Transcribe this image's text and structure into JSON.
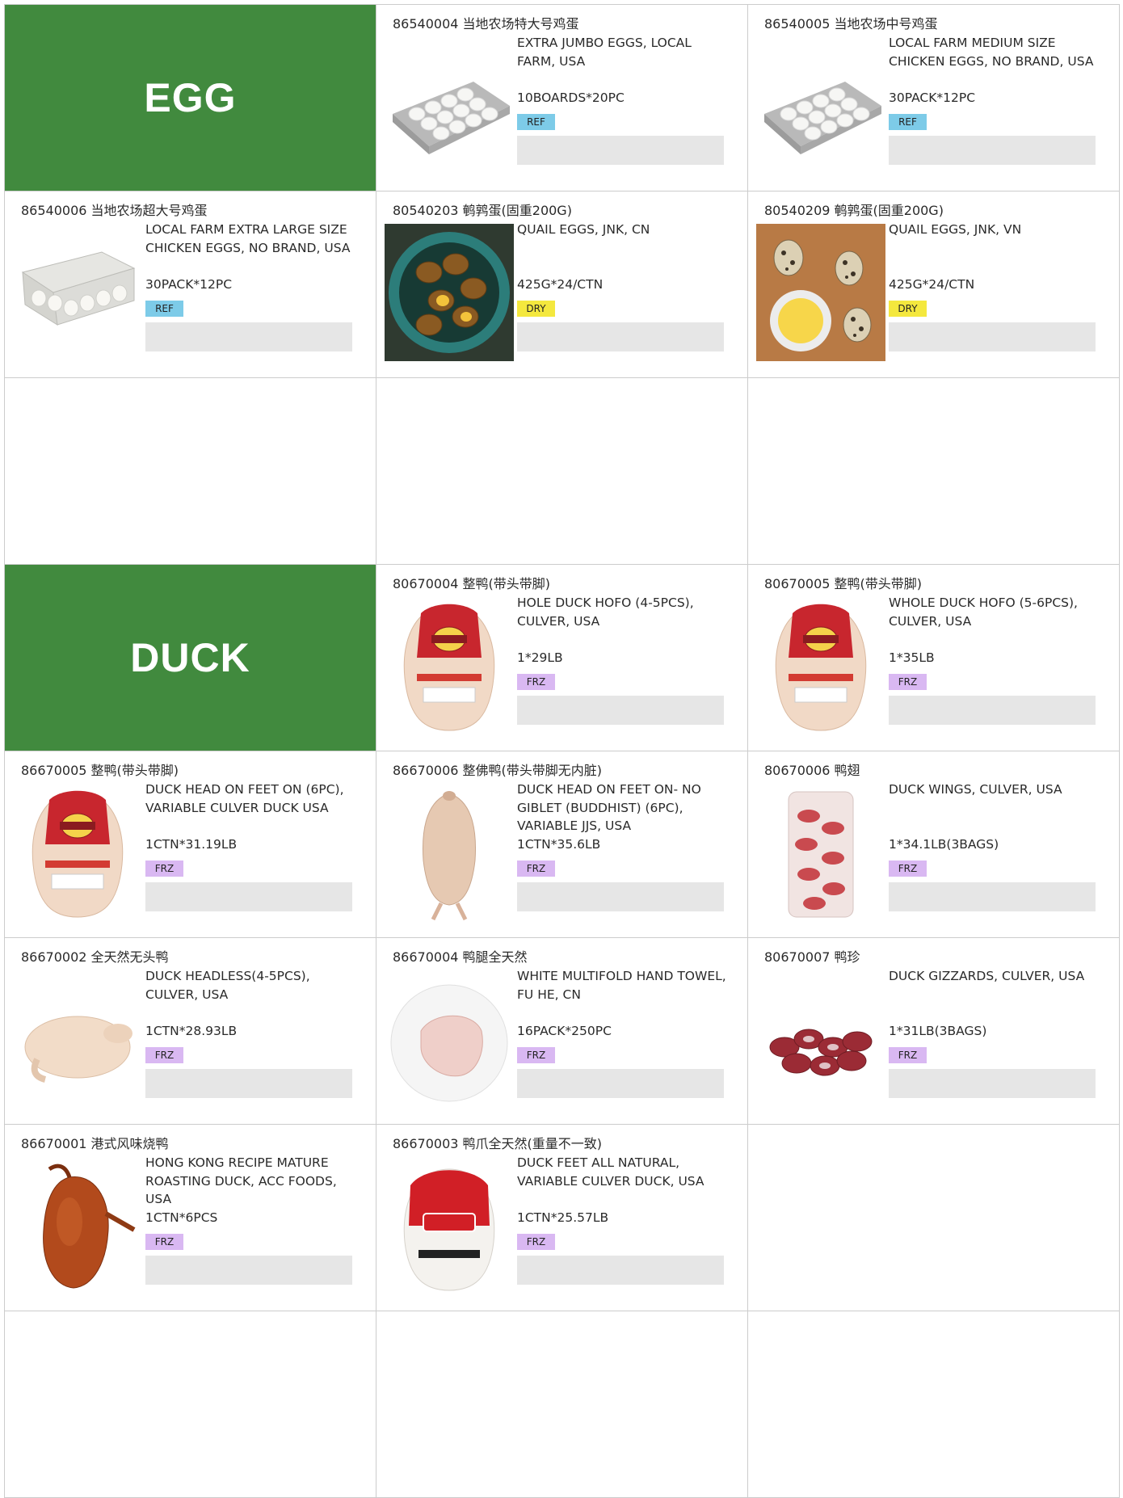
{
  "categories": {
    "egg": "EGG",
    "duck": "DUCK"
  },
  "badge_colors": {
    "REF": "#7dcbe8",
    "DRY": "#f4e83e",
    "FRZ": "#d9b8f2",
    "category_bg": "#418a3e"
  },
  "products": [
    {
      "title": "86540004 当地农场特大号鸡蛋",
      "desc": "EXTRA JUMBO EGGS, LOCAL FARM, USA",
      "pack": "10BOARDS*20PC",
      "storage": "REF",
      "icon": "egg-tray-icon"
    },
    {
      "title": "86540005 当地农场中号鸡蛋",
      "desc": "LOCAL FARM MEDIUM SIZE CHICKEN EGGS, NO BRAND, USA",
      "pack": "30PACK*12PC",
      "storage": "REF",
      "icon": "egg-tray-icon"
    },
    {
      "title": "86540006 当地农场超大号鸡蛋",
      "desc": "LOCAL FARM EXTRA LARGE SIZE CHICKEN EGGS, NO BRAND, USA",
      "pack": "30PACK*12PC",
      "storage": "REF",
      "icon": "egg-carton-icon"
    },
    {
      "title": "80540203 鹌鹑蛋(固重200G)",
      "desc": "QUAIL EGGS, JNK, CN",
      "pack": "425G*24/CTN",
      "storage": "DRY",
      "icon": "braised-quail-eggs-icon"
    },
    {
      "title": "80540209 鹌鹑蛋(固重200G)",
      "desc": "QUAIL EGGS, JNK, VN",
      "pack": "425G*24/CTN",
      "storage": "DRY",
      "icon": "quail-eggs-icon"
    },
    {
      "title": "80670004 整鸭(带头带脚)",
      "desc": "HOLE DUCK HOFO (4-5PCS), CULVER, USA",
      "pack": "1*29LB",
      "storage": "FRZ",
      "icon": "packaged-duck-icon"
    },
    {
      "title": "80670005 整鸭(带头带脚)",
      "desc": "WHOLE DUCK HOFO (5-6PCS), CULVER, USA",
      "pack": "1*35LB",
      "storage": "FRZ",
      "icon": "packaged-duck-icon"
    },
    {
      "title": "86670005 整鸭(带头带脚)",
      "desc": "DUCK HEAD ON FEET ON (6PC), VARIABLE CULVER DUCK USA",
      "pack": "1CTN*31.19LB",
      "storage": "FRZ",
      "icon": "packaged-duck-icon"
    },
    {
      "title": "86670006 整佛鸭(带头带脚无内脏)",
      "desc": "DUCK HEAD ON FEET ON- NO GIBLET (BUDDHIST) (6PC), VARIABLE JJS, USA",
      "pack": "1CTN*35.6LB",
      "storage": "FRZ",
      "icon": "buddhist-duck-icon"
    },
    {
      "title": "80670006 鸭翅",
      "desc": "DUCK WINGS, CULVER, USA",
      "pack": "1*34.1LB(3BAGS)",
      "storage": "FRZ",
      "icon": "duck-wings-bag-icon"
    },
    {
      "title": "86670002 全天然无头鸭",
      "desc": "DUCK HEADLESS(4-5PCS), CULVER, USA",
      "pack": "1CTN*28.93LB",
      "storage": "FRZ",
      "icon": "headless-duck-icon"
    },
    {
      "title": "86670004 鸭腿全天然",
      "desc": "WHITE MULTIFOLD HAND TOWEL, FU HE, CN",
      "pack": "16PACK*250PC",
      "storage": "FRZ",
      "icon": "duck-leg-plate-icon"
    },
    {
      "title": "80670007 鸭珍",
      "desc": "DUCK GIZZARDS, CULVER, USA",
      "pack": "1*31LB(3BAGS)",
      "storage": "FRZ",
      "icon": "duck-gizzards-icon"
    },
    {
      "title": "86670001 港式风味烧鸭",
      "desc": "HONG KONG RECIPE MATURE ROASTING DUCK, ACC FOODS, USA",
      "pack": "1CTN*6PCS",
      "storage": "FRZ",
      "icon": "roast-duck-icon"
    },
    {
      "title": "86670003 鸭爪全天然(重量不一致)",
      "desc": "DUCK FEET ALL NATURAL, VARIABLE CULVER DUCK, USA",
      "pack": "1CTN*25.57LB",
      "storage": "FRZ",
      "icon": "whole-duck-bag-icon"
    }
  ]
}
